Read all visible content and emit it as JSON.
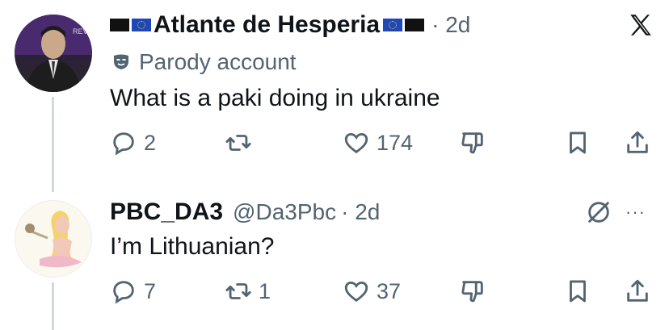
{
  "tweet1": {
    "flags_before": [
      "black",
      "eu"
    ],
    "display_name": "Atlante de Hesperia",
    "flags_after": [
      "eu",
      "black"
    ],
    "dot_time": "· 2d",
    "label": "Parody account",
    "text": "What is a paki doing in ukraine",
    "avatar_text": "REVO",
    "actions": {
      "replies": "2",
      "retweets": "",
      "likes": "174"
    }
  },
  "tweet2": {
    "display_name": "PBC_DA3",
    "handle": "@Da3Pbc",
    "dot_time": "· 2d",
    "text": "I’m Lithuanian?",
    "more": "···",
    "actions": {
      "replies": "7",
      "retweets": "1",
      "likes": "37"
    }
  },
  "icons": {
    "close": "x-logo-icon",
    "parody": "mask-icon",
    "reply": "reply-icon",
    "retweet": "retweet-icon",
    "like": "heart-icon",
    "dislike": "thumbs-down-icon",
    "bookmark": "bookmark-icon",
    "share": "share-icon",
    "mute": "slashed-circle-icon"
  },
  "colors": {
    "text": "#0f1419",
    "muted": "#536471",
    "line": "#cfd9de",
    "eu_blue": "#1f47b8"
  }
}
